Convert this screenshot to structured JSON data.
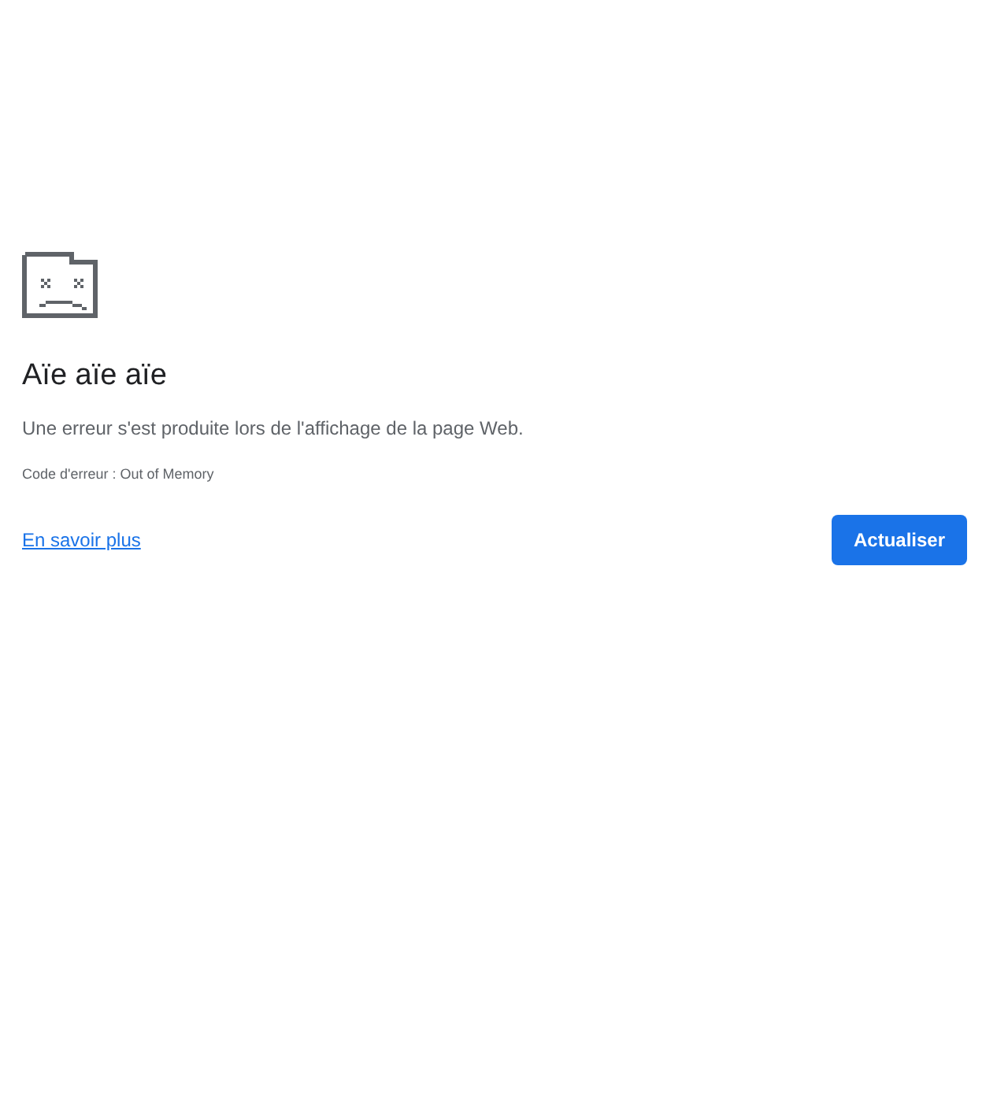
{
  "error_page": {
    "title": "Aïe aïe aïe",
    "message": "Une erreur s'est produite lors de l'affichage de la page Web.",
    "error_code": "Code d'erreur : Out of Memory",
    "learn_more_link": "En savoir plus",
    "reload_button": "Actualiser"
  }
}
